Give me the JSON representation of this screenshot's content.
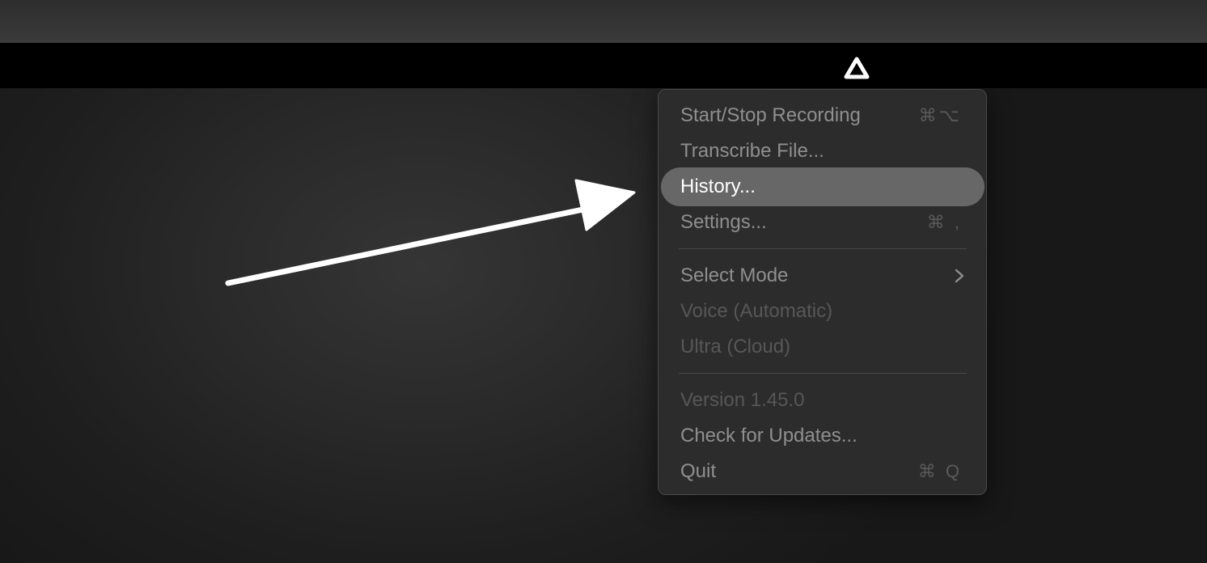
{
  "menubar": {
    "status_icon": "triangle-logo-icon"
  },
  "annotation": {
    "icon": "arrow-pointer-icon",
    "color": "#ffffff"
  },
  "menu": {
    "items": [
      {
        "label": "Start/Stop Recording",
        "shortcut": "⌘⌥",
        "state": "normal"
      },
      {
        "label": "Transcribe File...",
        "shortcut": "",
        "state": "normal"
      },
      {
        "label": "History...",
        "shortcut": "",
        "state": "highlighted"
      },
      {
        "label": "Settings...",
        "shortcut": "⌘ ,",
        "state": "normal"
      },
      {
        "label": "Select Mode",
        "submenu_icon": "chevron-right-icon",
        "state": "normal"
      },
      {
        "label": "Voice (Automatic)",
        "state": "disabled"
      },
      {
        "label": "Ultra (Cloud)",
        "state": "disabled"
      },
      {
        "label": "Version 1.45.0",
        "state": "disabled"
      },
      {
        "label": "Check for Updates...",
        "shortcut": "",
        "state": "normal"
      },
      {
        "label": "Quit",
        "shortcut": "⌘ Q",
        "state": "normal"
      }
    ]
  },
  "colors": {
    "menu_background": "#2c2c2c",
    "highlight": "#676767",
    "text": "#8f8f8f",
    "disabled_text": "#575757",
    "menubar": "#000000"
  }
}
